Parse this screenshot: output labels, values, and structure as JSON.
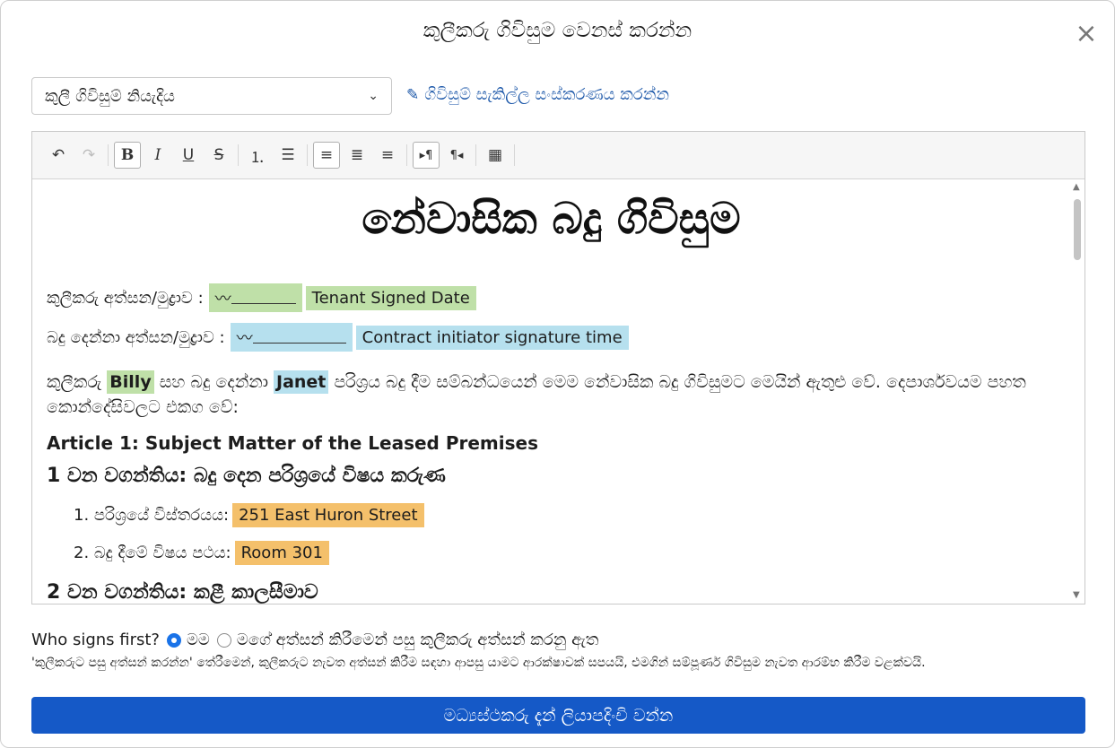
{
  "dialog": {
    "title": "කුලීකරු ගිවිසුම වෙනස් කරන්න",
    "close_glyph": "×"
  },
  "template_select": {
    "value": "කුලී ගිවිසුම් නියැදිය",
    "chevron_glyph": "⌄"
  },
  "edit_template_link": {
    "icon": "edit-icon",
    "icon_glyph": "✎",
    "label": "ගිවිසුම් සැකිල්ල සංස්කරණය කරන්න"
  },
  "toolbar": {
    "buttons": [
      {
        "name": "undo",
        "glyph": "↶",
        "state": "enabled"
      },
      {
        "name": "redo",
        "glyph": "↷",
        "state": "disabled"
      },
      {
        "name": "bold",
        "glyph": "B",
        "state": "active"
      },
      {
        "name": "italic",
        "glyph": "I",
        "state": "enabled"
      },
      {
        "name": "underline",
        "glyph": "U",
        "state": "enabled"
      },
      {
        "name": "strikethrough",
        "glyph": "S",
        "state": "enabled"
      },
      {
        "name": "ordered-list",
        "glyph": "⒈",
        "state": "enabled"
      },
      {
        "name": "bullet-list",
        "glyph": "☰",
        "state": "enabled"
      },
      {
        "name": "align-left",
        "glyph": "≡",
        "state": "active"
      },
      {
        "name": "align-center",
        "glyph": "≣",
        "state": "enabled"
      },
      {
        "name": "align-right",
        "glyph": "≡",
        "state": "enabled"
      },
      {
        "name": "ltr",
        "glyph": "▸¶",
        "state": "active"
      },
      {
        "name": "rtl",
        "glyph": "¶◂",
        "state": "enabled"
      },
      {
        "name": "table",
        "glyph": "▦",
        "state": "enabled"
      }
    ]
  },
  "document": {
    "title": "නේවාසික බදු ගිවිසුම",
    "tenant_sign_label": "කුලීකරු අත්සන/මුද්‍රාව :",
    "tenant_sign_glyph": "〰",
    "tenant_signed_date": "Tenant Signed Date",
    "landlord_sign_label": "බදු දෙන්නා අත්සන/මුද්‍රාව :",
    "landlord_sign_glyph": "〰",
    "initiator_time": "Contract initiator signature time",
    "para_part1": "කුලීකරු",
    "tenant_name": "Billy",
    "para_part2": "සහ බදු දෙන්නා",
    "landlord_name": "Janet",
    "para_part3": "පරිශ්‍රය බදු දීම සම්බන්ධයෙන් මෙම නේවාසික බදු ගිවිසුමට මෙයින් ඇතුළු වේ. දෙපාර්ශවයම පහත කොන්දේසිවලට එකග වේ:",
    "article1_en": "Article 1: Subject Matter of the Leased Premises",
    "article1_si": "1 වන වගන්තිය: බදු දෙන පරිශ්‍රයේ විෂය කරුණ",
    "items": [
      {
        "num": "1.",
        "label": "පරිශ්‍රයේ විස්තරයය:",
        "value": "251 East Huron Street"
      },
      {
        "num": "2.",
        "label": "බදු දීමේ විෂය පථය:",
        "value": "Room 301"
      }
    ],
    "article2_si": "2 වන වගන්තිය: කළී කාලසීමාව"
  },
  "signing": {
    "question": "Who signs first?",
    "option_me": "මම",
    "option_after": "මගේ අත්සන් කිරීමෙන් පසු කුලීකරු අත්සන් කරනු ඇත",
    "selected": "me",
    "note": "'කුලීකරුට පසු අත්සන් කරන්න' තේරීමෙන්, කුලීකරුට නැවත අත්සන් කිරීම සඳහා ආපසු යාමට ආරක්ෂාවක් සපයයි, එමගින් සම්පූර්ණ ගිවිසුම නැවත ආරම්භ කිරීම වළක්වයි."
  },
  "primary_button": {
    "label": "මධ්‍යස්ථකරු දැන් ලියාපදිංචි වන්න"
  },
  "colors": {
    "accent": "#1559c7",
    "link": "#1a56a8",
    "tenant_highlight": "#bfe0a8",
    "landlord_highlight": "#b6e0ee",
    "field_highlight": "#f4c06b"
  }
}
